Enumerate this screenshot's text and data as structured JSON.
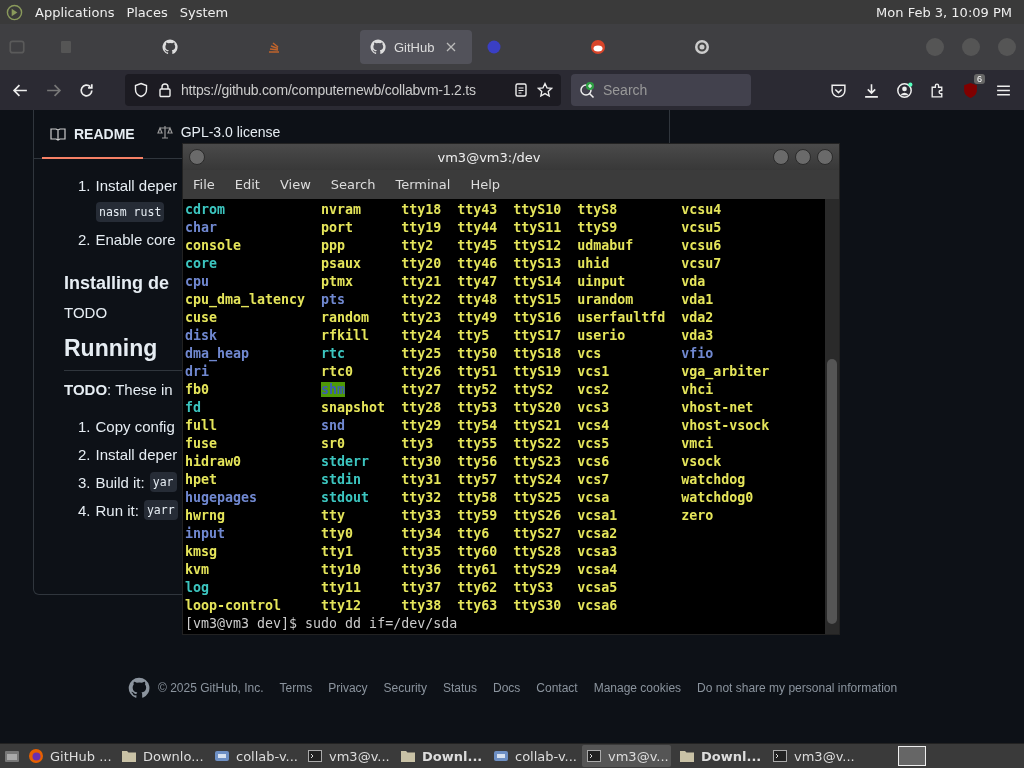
{
  "top_panel": {
    "menus": [
      "Applications",
      "Places",
      "System"
    ],
    "clock": "Mon Feb  3, 10:09 PM"
  },
  "browser": {
    "tabs": [
      {
        "selected": false
      },
      {
        "selected": false
      },
      {
        "selected": false
      },
      {
        "label": "GitHub",
        "selected": true
      },
      {
        "selected": false
      },
      {
        "selected": false
      },
      {
        "selected": false
      }
    ],
    "url": "https://github.com/computernewb/collabvm-1.2.ts",
    "search": {
      "placeholder": "Search"
    },
    "extension_badge": "6"
  },
  "readme": {
    "tabs": [
      {
        "label": "README",
        "selected": true
      },
      {
        "label": "GPL-3.0 license",
        "selected": false
      }
    ],
    "blocks": [
      {
        "kind": "item",
        "number": "1.",
        "text": "Install deper"
      },
      {
        "kind": "code",
        "text": "nasm rust"
      },
      {
        "kind": "item",
        "number": "2.",
        "text": "Enable core"
      },
      {
        "kind": "h3",
        "text": "Installing de"
      },
      {
        "kind": "p",
        "text": "TODO"
      },
      {
        "kind": "h2",
        "text": "Running"
      },
      {
        "kind": "p",
        "text": "**TODO**: These in"
      },
      {
        "kind": "item",
        "number": "1.",
        "text": "Copy config"
      },
      {
        "kind": "item",
        "number": "2.",
        "text": "Install deper"
      },
      {
        "kind": "item",
        "number": "3.",
        "text": "Build it:",
        "code": "yar"
      },
      {
        "kind": "item",
        "number": "4.",
        "text": "Run it:",
        "code": "yarr"
      }
    ]
  },
  "footer": {
    "copyright": "© 2025 GitHub, Inc.",
    "links": [
      "Terms",
      "Privacy",
      "Security",
      "Status",
      "Docs",
      "Contact",
      "Manage cookies",
      "Do not share my personal information"
    ]
  },
  "terminal": {
    "title": "vm3@vm3:/dev",
    "menu": [
      "File",
      "Edit",
      "View",
      "Search",
      "Terminal",
      "Help"
    ],
    "columns": [
      [
        {
          "name": "cdrom",
          "kind": "link"
        },
        {
          "name": "char",
          "kind": "dir"
        },
        {
          "name": "console",
          "kind": "device"
        },
        {
          "name": "core",
          "kind": "link"
        },
        {
          "name": "cpu",
          "kind": "dir"
        },
        {
          "name": "cpu_dma_latency",
          "kind": "device"
        },
        {
          "name": "cuse",
          "kind": "device"
        },
        {
          "name": "disk",
          "kind": "dir"
        },
        {
          "name": "dma_heap",
          "kind": "dir"
        },
        {
          "name": "dri",
          "kind": "dir"
        },
        {
          "name": "fb0",
          "kind": "device"
        },
        {
          "name": "fd",
          "kind": "link"
        },
        {
          "name": "full",
          "kind": "device"
        },
        {
          "name": "fuse",
          "kind": "device"
        },
        {
          "name": "hidraw0",
          "kind": "device"
        },
        {
          "name": "hpet",
          "kind": "device"
        },
        {
          "name": "hugepages",
          "kind": "dir"
        },
        {
          "name": "hwrng",
          "kind": "device"
        },
        {
          "name": "input",
          "kind": "dir"
        },
        {
          "name": "kmsg",
          "kind": "device"
        },
        {
          "name": "kvm",
          "kind": "device"
        },
        {
          "name": "log",
          "kind": "link"
        },
        {
          "name": "loop-control",
          "kind": "device"
        }
      ],
      [
        {
          "name": "nvram",
          "kind": "device"
        },
        {
          "name": "port",
          "kind": "device"
        },
        {
          "name": "ppp",
          "kind": "device"
        },
        {
          "name": "psaux",
          "kind": "device"
        },
        {
          "name": "ptmx",
          "kind": "device"
        },
        {
          "name": "pts",
          "kind": "dir"
        },
        {
          "name": "random",
          "kind": "device"
        },
        {
          "name": "rfkill",
          "kind": "device"
        },
        {
          "name": "rtc",
          "kind": "link"
        },
        {
          "name": "rtc0",
          "kind": "device"
        },
        {
          "name": "shm",
          "kind": "sticky"
        },
        {
          "name": "snapshot",
          "kind": "device"
        },
        {
          "name": "snd",
          "kind": "dir"
        },
        {
          "name": "sr0",
          "kind": "device"
        },
        {
          "name": "stderr",
          "kind": "link"
        },
        {
          "name": "stdin",
          "kind": "link"
        },
        {
          "name": "stdout",
          "kind": "link"
        },
        {
          "name": "tty",
          "kind": "device"
        },
        {
          "name": "tty0",
          "kind": "device"
        },
        {
          "name": "tty1",
          "kind": "device"
        },
        {
          "name": "tty10",
          "kind": "device"
        },
        {
          "name": "tty11",
          "kind": "device"
        },
        {
          "name": "tty12",
          "kind": "device"
        }
      ],
      [
        {
          "name": "tty18",
          "kind": "device"
        },
        {
          "name": "tty19",
          "kind": "device"
        },
        {
          "name": "tty2",
          "kind": "device"
        },
        {
          "name": "tty20",
          "kind": "device"
        },
        {
          "name": "tty21",
          "kind": "device"
        },
        {
          "name": "tty22",
          "kind": "device"
        },
        {
          "name": "tty23",
          "kind": "device"
        },
        {
          "name": "tty24",
          "kind": "device"
        },
        {
          "name": "tty25",
          "kind": "device"
        },
        {
          "name": "tty26",
          "kind": "device"
        },
        {
          "name": "tty27",
          "kind": "device"
        },
        {
          "name": "tty28",
          "kind": "device"
        },
        {
          "name": "tty29",
          "kind": "device"
        },
        {
          "name": "tty3",
          "kind": "device"
        },
        {
          "name": "tty30",
          "kind": "device"
        },
        {
          "name": "tty31",
          "kind": "device"
        },
        {
          "name": "tty32",
          "kind": "device"
        },
        {
          "name": "tty33",
          "kind": "device"
        },
        {
          "name": "tty34",
          "kind": "device"
        },
        {
          "name": "tty35",
          "kind": "device"
        },
        {
          "name": "tty36",
          "kind": "device"
        },
        {
          "name": "tty37",
          "kind": "device"
        },
        {
          "name": "tty38",
          "kind": "device"
        }
      ],
      [
        {
          "name": "tty43",
          "kind": "device"
        },
        {
          "name": "tty44",
          "kind": "device"
        },
        {
          "name": "tty45",
          "kind": "device"
        },
        {
          "name": "tty46",
          "kind": "device"
        },
        {
          "name": "tty47",
          "kind": "device"
        },
        {
          "name": "tty48",
          "kind": "device"
        },
        {
          "name": "tty49",
          "kind": "device"
        },
        {
          "name": "tty5",
          "kind": "device"
        },
        {
          "name": "tty50",
          "kind": "device"
        },
        {
          "name": "tty51",
          "kind": "device"
        },
        {
          "name": "tty52",
          "kind": "device"
        },
        {
          "name": "tty53",
          "kind": "device"
        },
        {
          "name": "tty54",
          "kind": "device"
        },
        {
          "name": "tty55",
          "kind": "device"
        },
        {
          "name": "tty56",
          "kind": "device"
        },
        {
          "name": "tty57",
          "kind": "device"
        },
        {
          "name": "tty58",
          "kind": "device"
        },
        {
          "name": "tty59",
          "kind": "device"
        },
        {
          "name": "tty6",
          "kind": "device"
        },
        {
          "name": "tty60",
          "kind": "device"
        },
        {
          "name": "tty61",
          "kind": "device"
        },
        {
          "name": "tty62",
          "kind": "device"
        },
        {
          "name": "tty63",
          "kind": "device"
        }
      ],
      [
        {
          "name": "ttyS10",
          "kind": "device"
        },
        {
          "name": "ttyS11",
          "kind": "device"
        },
        {
          "name": "ttyS12",
          "kind": "device"
        },
        {
          "name": "ttyS13",
          "kind": "device"
        },
        {
          "name": "ttyS14",
          "kind": "device"
        },
        {
          "name": "ttyS15",
          "kind": "device"
        },
        {
          "name": "ttyS16",
          "kind": "device"
        },
        {
          "name": "ttyS17",
          "kind": "device"
        },
        {
          "name": "ttyS18",
          "kind": "device"
        },
        {
          "name": "ttyS19",
          "kind": "device"
        },
        {
          "name": "ttyS2",
          "kind": "device"
        },
        {
          "name": "ttyS20",
          "kind": "device"
        },
        {
          "name": "ttyS21",
          "kind": "device"
        },
        {
          "name": "ttyS22",
          "kind": "device"
        },
        {
          "name": "ttyS23",
          "kind": "device"
        },
        {
          "name": "ttyS24",
          "kind": "device"
        },
        {
          "name": "ttyS25",
          "kind": "device"
        },
        {
          "name": "ttyS26",
          "kind": "device"
        },
        {
          "name": "ttyS27",
          "kind": "device"
        },
        {
          "name": "ttyS28",
          "kind": "device"
        },
        {
          "name": "ttyS29",
          "kind": "device"
        },
        {
          "name": "ttyS3",
          "kind": "device"
        },
        {
          "name": "ttyS30",
          "kind": "device"
        }
      ],
      [
        {
          "name": "ttyS8",
          "kind": "device"
        },
        {
          "name": "ttyS9",
          "kind": "device"
        },
        {
          "name": "udmabuf",
          "kind": "device"
        },
        {
          "name": "uhid",
          "kind": "device"
        },
        {
          "name": "uinput",
          "kind": "device"
        },
        {
          "name": "urandom",
          "kind": "device"
        },
        {
          "name": "userfaultfd",
          "kind": "device"
        },
        {
          "name": "userio",
          "kind": "device"
        },
        {
          "name": "vcs",
          "kind": "device"
        },
        {
          "name": "vcs1",
          "kind": "device"
        },
        {
          "name": "vcs2",
          "kind": "device"
        },
        {
          "name": "vcs3",
          "kind": "device"
        },
        {
          "name": "vcs4",
          "kind": "device"
        },
        {
          "name": "vcs5",
          "kind": "device"
        },
        {
          "name": "vcs6",
          "kind": "device"
        },
        {
          "name": "vcs7",
          "kind": "device"
        },
        {
          "name": "vcsa",
          "kind": "device"
        },
        {
          "name": "vcsa1",
          "kind": "device"
        },
        {
          "name": "vcsa2",
          "kind": "device"
        },
        {
          "name": "vcsa3",
          "kind": "device"
        },
        {
          "name": "vcsa4",
          "kind": "device"
        },
        {
          "name": "vcsa5",
          "kind": "device"
        },
        {
          "name": "vcsa6",
          "kind": "device"
        }
      ],
      [
        {
          "name": "vcsu4",
          "kind": "device"
        },
        {
          "name": "vcsu5",
          "kind": "device"
        },
        {
          "name": "vcsu6",
          "kind": "device"
        },
        {
          "name": "vcsu7",
          "kind": "device"
        },
        {
          "name": "vda",
          "kind": "device"
        },
        {
          "name": "vda1",
          "kind": "device"
        },
        {
          "name": "vda2",
          "kind": "device"
        },
        {
          "name": "vda3",
          "kind": "device"
        },
        {
          "name": "vfio",
          "kind": "dir"
        },
        {
          "name": "vga_arbiter",
          "kind": "device"
        },
        {
          "name": "vhci",
          "kind": "device"
        },
        {
          "name": "vhost-net",
          "kind": "device"
        },
        {
          "name": "vhost-vsock",
          "kind": "device"
        },
        {
          "name": "vmci",
          "kind": "device"
        },
        {
          "name": "vsock",
          "kind": "device"
        },
        {
          "name": "watchdog",
          "kind": "device"
        },
        {
          "name": "watchdog0",
          "kind": "device"
        },
        {
          "name": "zero",
          "kind": "device"
        }
      ]
    ],
    "prompt": "[vm3@vm3 dev]$ sudo dd if=/dev/sda"
  },
  "taskbar": {
    "items": [
      {
        "kind": "browser",
        "label": "GitHub ...",
        "selected": false,
        "attention": false
      },
      {
        "kind": "folder",
        "label": "Downlo...",
        "selected": false,
        "attention": false
      },
      {
        "kind": "app",
        "label": "collab-v...",
        "selected": false,
        "attention": false
      },
      {
        "kind": "terminal",
        "label": "vm3@v...",
        "selected": false,
        "attention": false
      },
      {
        "kind": "folder",
        "label": "Downl...",
        "selected": false,
        "attention": true
      },
      {
        "kind": "app",
        "label": "collab-v...",
        "selected": false,
        "attention": false
      },
      {
        "kind": "terminal",
        "label": "vm3@v...",
        "selected": true,
        "attention": false
      },
      {
        "kind": "folder",
        "label": "Downl...",
        "selected": false,
        "attention": true
      },
      {
        "kind": "terminal",
        "label": "vm3@v...",
        "selected": false,
        "attention": false
      }
    ]
  }
}
